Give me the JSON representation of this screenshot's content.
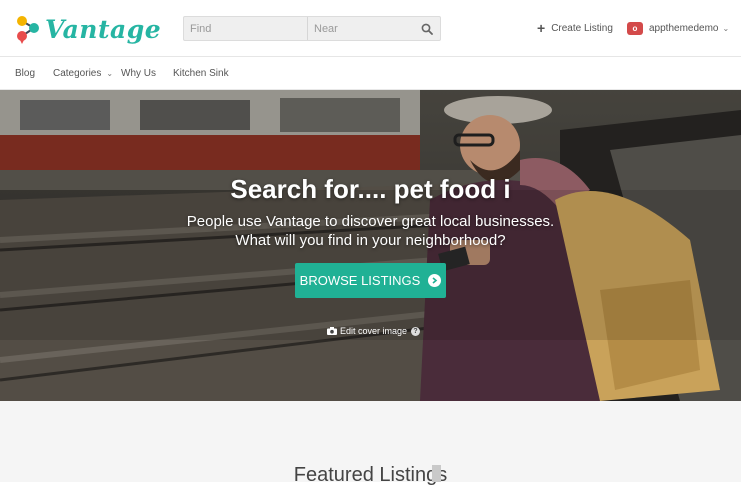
{
  "brand": {
    "name": "Vantage",
    "accent": "#26b5a3"
  },
  "search": {
    "find_placeholder": "Find",
    "near_placeholder": "Near",
    "icon": "search-icon"
  },
  "header": {
    "create_label": "Create Listing",
    "username": "appthemedemo"
  },
  "nav": {
    "items": [
      {
        "label": "Blog"
      },
      {
        "label": "Categories"
      },
      {
        "label": "Why Us"
      },
      {
        "label": "Kitchen Sink"
      }
    ]
  },
  "hero": {
    "title": "Search for.... pet food i",
    "subtitle_line1": "People use Vantage to discover great local businesses.",
    "subtitle_line2": "What will you find in your neighborhood?",
    "browse_label": "BROWSE LISTINGS",
    "edit_cover_label": "Edit cover image",
    "button_color": "#20b195"
  },
  "featured": {
    "title": "Featured Listings"
  }
}
